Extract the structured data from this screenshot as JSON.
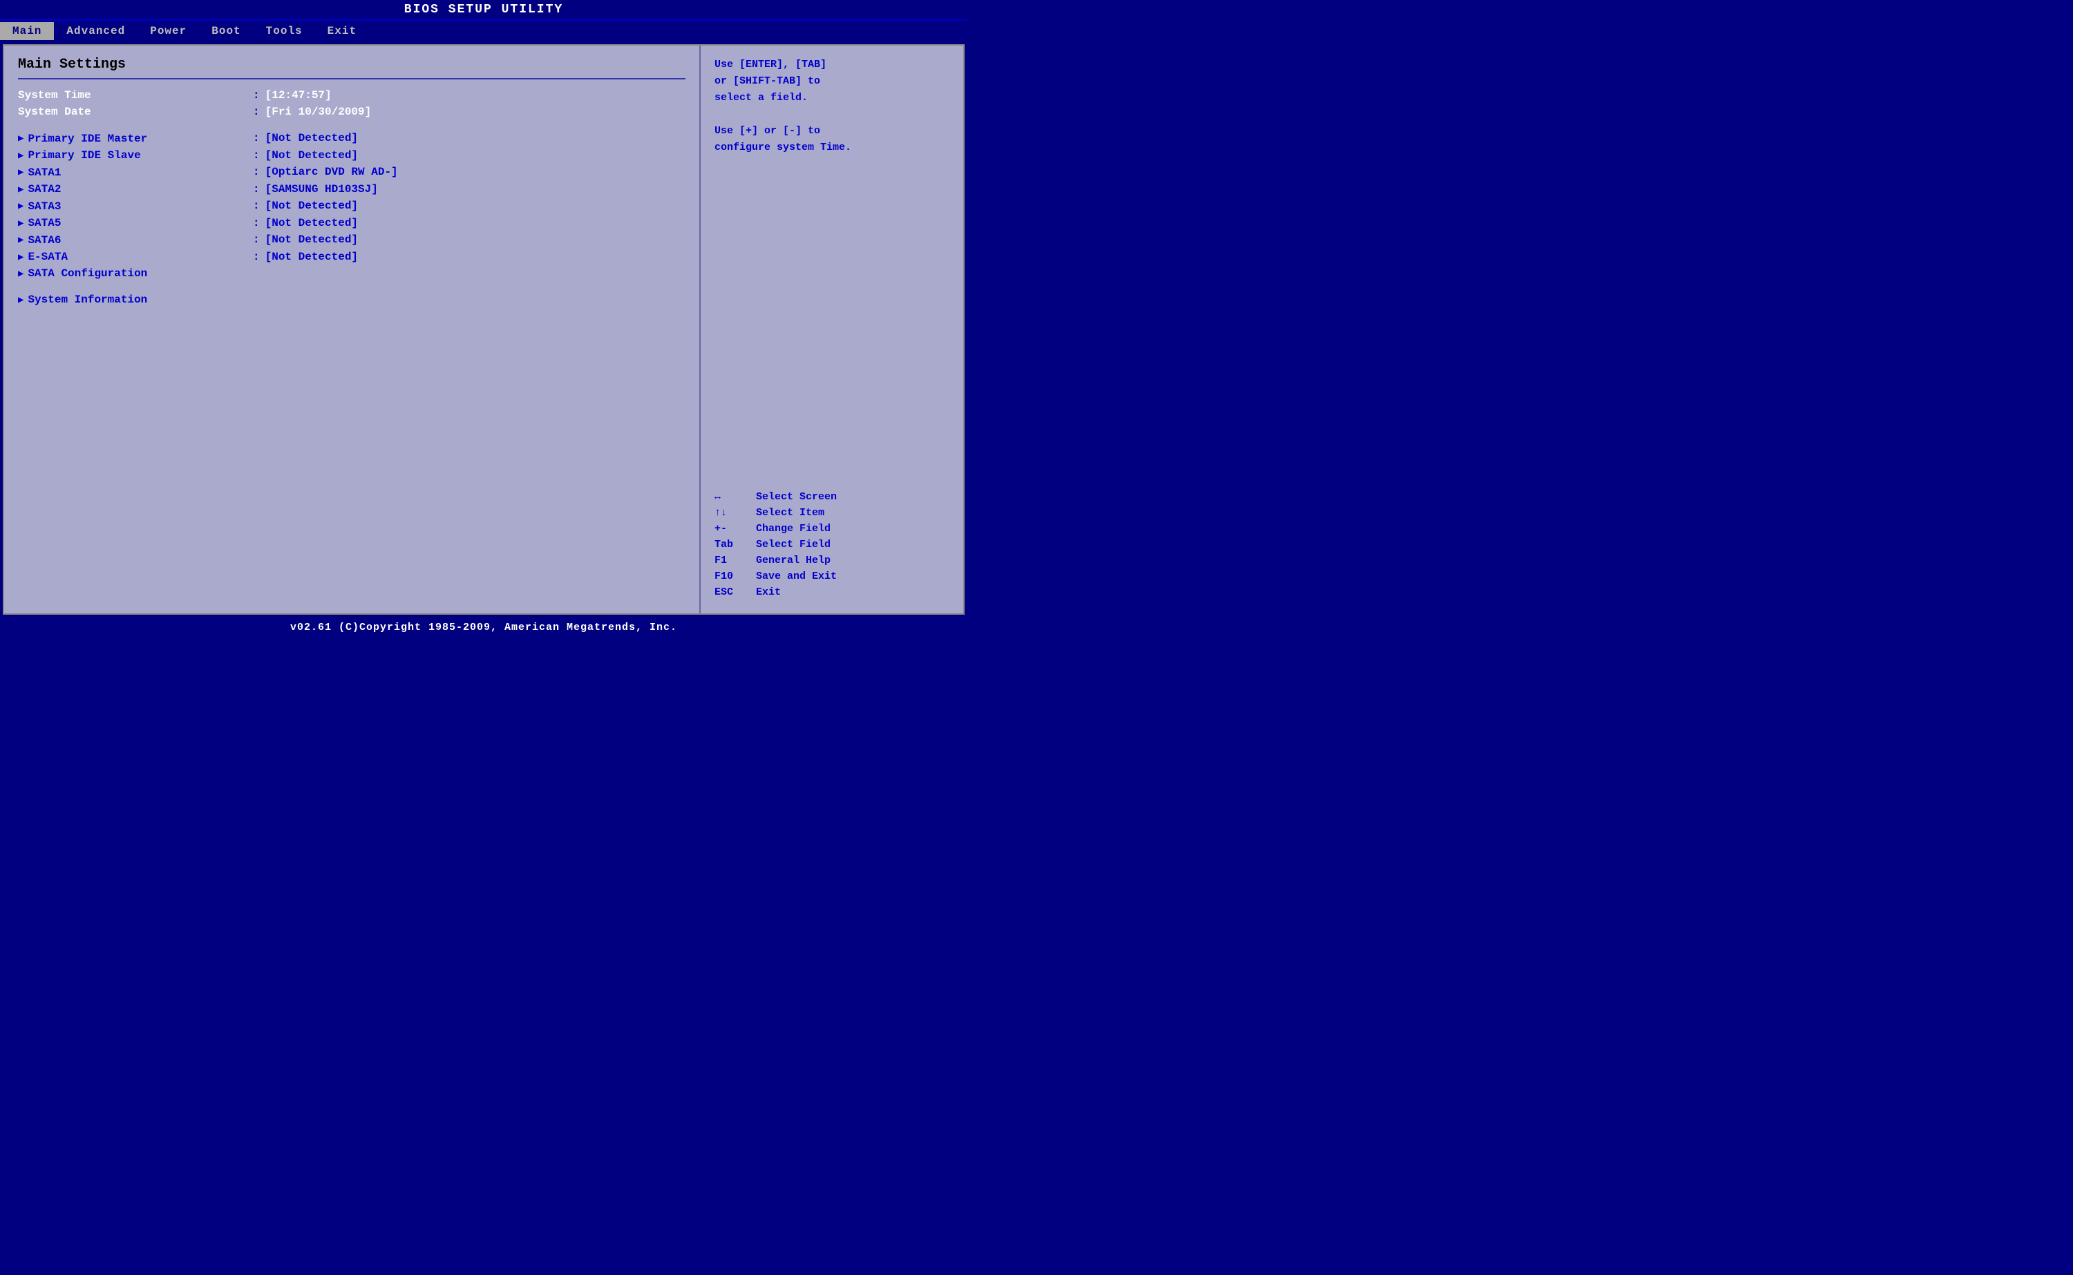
{
  "title_bar": {
    "title": "BIOS  SETUP  UTILITY"
  },
  "nav": {
    "items": [
      {
        "label": "Main",
        "active": true
      },
      {
        "label": "Advanced",
        "active": false
      },
      {
        "label": "Power",
        "active": false
      },
      {
        "label": "Boot",
        "active": false
      },
      {
        "label": "Tools",
        "active": false
      },
      {
        "label": "Exit",
        "active": false
      }
    ]
  },
  "left_panel": {
    "section_title": "Main Settings",
    "rows": [
      {
        "type": "plain",
        "label": "System Time",
        "value": "[12:47:57]",
        "label_white": true,
        "value_white": true
      },
      {
        "type": "plain",
        "label": "System Date",
        "value": "[Fri 10/30/2009]",
        "label_white": true,
        "value_white": true
      },
      {
        "type": "spacer"
      },
      {
        "type": "arrow",
        "label": "Primary IDE Master",
        "value": "[Not Detected]"
      },
      {
        "type": "arrow",
        "label": "Primary IDE Slave",
        "value": "[Not Detected]"
      },
      {
        "type": "arrow",
        "label": "SATA1",
        "value": "[Optiarc DVD RW AD-]"
      },
      {
        "type": "arrow",
        "label": "SATA2",
        "value": "[SAMSUNG HD103SJ]"
      },
      {
        "type": "arrow",
        "label": "SATA3",
        "value": "[Not Detected]"
      },
      {
        "type": "arrow",
        "label": "SATA5",
        "value": "[Not Detected]"
      },
      {
        "type": "arrow",
        "label": "SATA6",
        "value": "[Not Detected]"
      },
      {
        "type": "arrow",
        "label": "E-SATA",
        "value": "[Not Detected]"
      },
      {
        "type": "arrow-novalue",
        "label": "SATA Configuration"
      },
      {
        "type": "spacer"
      },
      {
        "type": "arrow-novalue",
        "label": "System Information"
      }
    ]
  },
  "right_panel": {
    "help_lines": [
      "Use [ENTER], [TAB]",
      "or [SHIFT-TAB] to",
      "select a field.",
      "",
      "Use [+] or [-] to",
      "configure system Time."
    ],
    "key_help": [
      {
        "key": "↔",
        "desc": "Select Screen"
      },
      {
        "key": "↑↓",
        "desc": "Select Item"
      },
      {
        "key": "+-",
        "desc": "Change Field"
      },
      {
        "key": "Tab",
        "desc": "Select Field"
      },
      {
        "key": "F1",
        "desc": "General Help"
      },
      {
        "key": "F10",
        "desc": "Save and Exit"
      },
      {
        "key": "ESC",
        "desc": "Exit"
      }
    ]
  },
  "footer": {
    "text": "v02.61  (C)Copyright 1985-2009, American Megatrends, Inc."
  }
}
